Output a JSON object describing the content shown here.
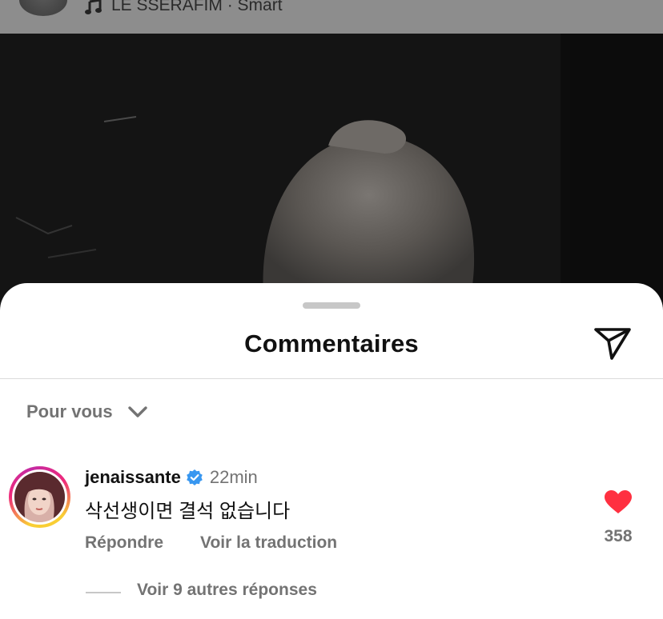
{
  "post": {
    "music_label": "LE SSERAFIM · Smart"
  },
  "sheet": {
    "title": "Commentaires",
    "sort_label": "Pour vous"
  },
  "comment": {
    "username": "jenaissante",
    "verified": true,
    "time": "22min",
    "text": "삭선생이면 결석 없습니다",
    "reply_label": "Répondre",
    "translate_label": "Voir la traduction",
    "like_count": "358",
    "liked": true,
    "view_replies_label": "Voir 9 autres réponses"
  },
  "colors": {
    "like_red": "#ff3040",
    "verified_blue": "#3897f0",
    "muted_text": "#737373",
    "story_ring": [
      "#f9ce34",
      "#ee2a7b",
      "#c32aa3"
    ]
  },
  "icons": {
    "music": "music-note-icon",
    "share": "paper-plane-icon",
    "sort": "chevron-down-icon",
    "verified": "verified-badge-icon",
    "like": "heart-icon"
  }
}
